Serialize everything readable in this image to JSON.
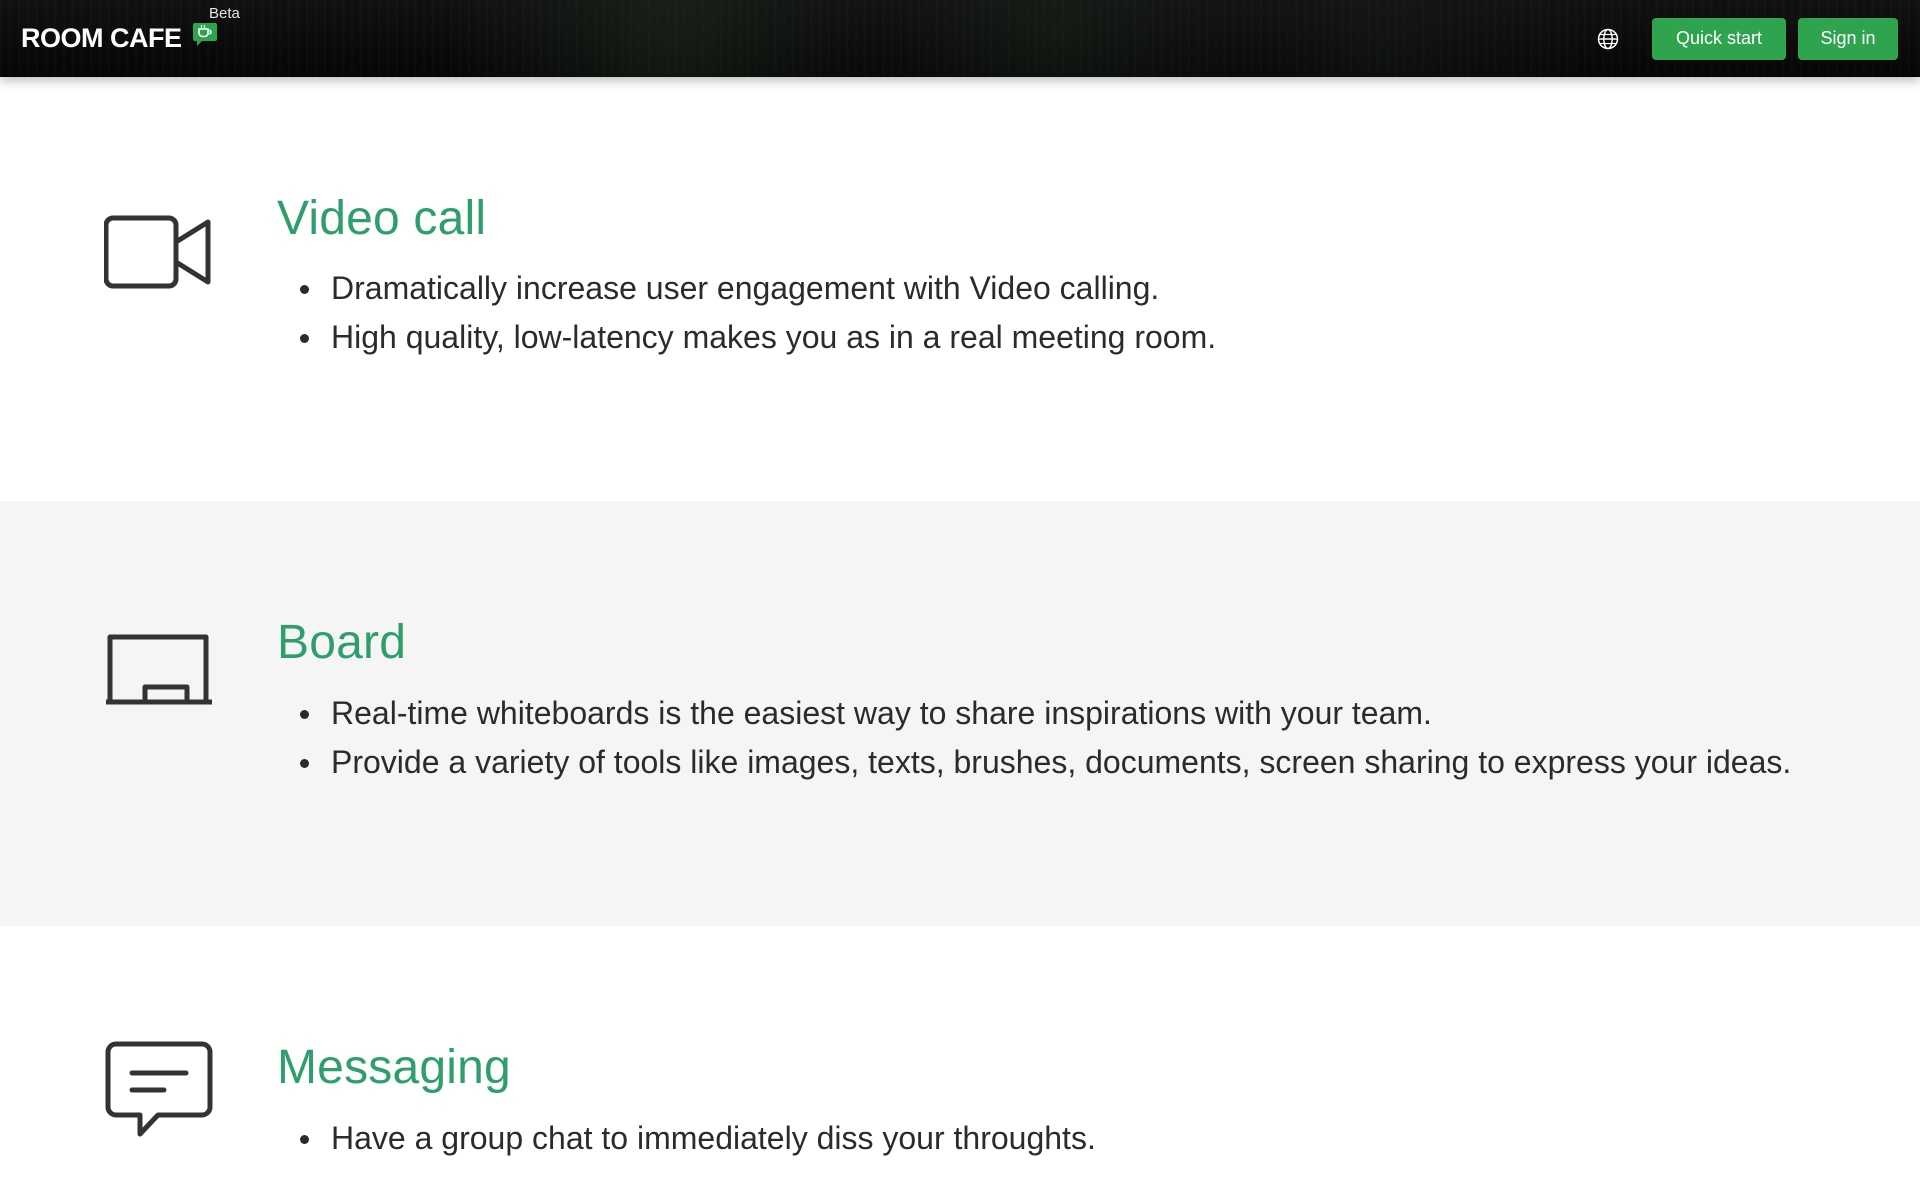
{
  "header": {
    "brand_name": "ROOM CAFE",
    "beta_label": "Beta",
    "quick_start_label": "Quick start",
    "sign_in_label": "Sign in",
    "accent_color": "#2ea44f",
    "icons": [
      "chat-cup-logo-icon",
      "globe-icon"
    ]
  },
  "features": [
    {
      "icon": "video-camera-icon",
      "title": "Video call",
      "bullets": [
        "Dramatically increase user engagement with Video calling.",
        "High quality, low-latency makes you as in a real meeting room."
      ]
    },
    {
      "icon": "whiteboard-icon",
      "title": "Board",
      "bullets": [
        "Real-time whiteboards is the easiest way to share inspirations with your team.",
        "Provide a variety of tools like images, texts, brushes, documents, screen sharing to express your ideas."
      ]
    },
    {
      "icon": "message-icon",
      "title": "Messaging",
      "bullets": [
        "Have a group chat to immediately diss your throughts."
      ]
    }
  ],
  "colors": {
    "title_green": "#2e9e6b",
    "body_text": "#2b2b2b",
    "alt_section_bg": "#f5f5f5"
  }
}
